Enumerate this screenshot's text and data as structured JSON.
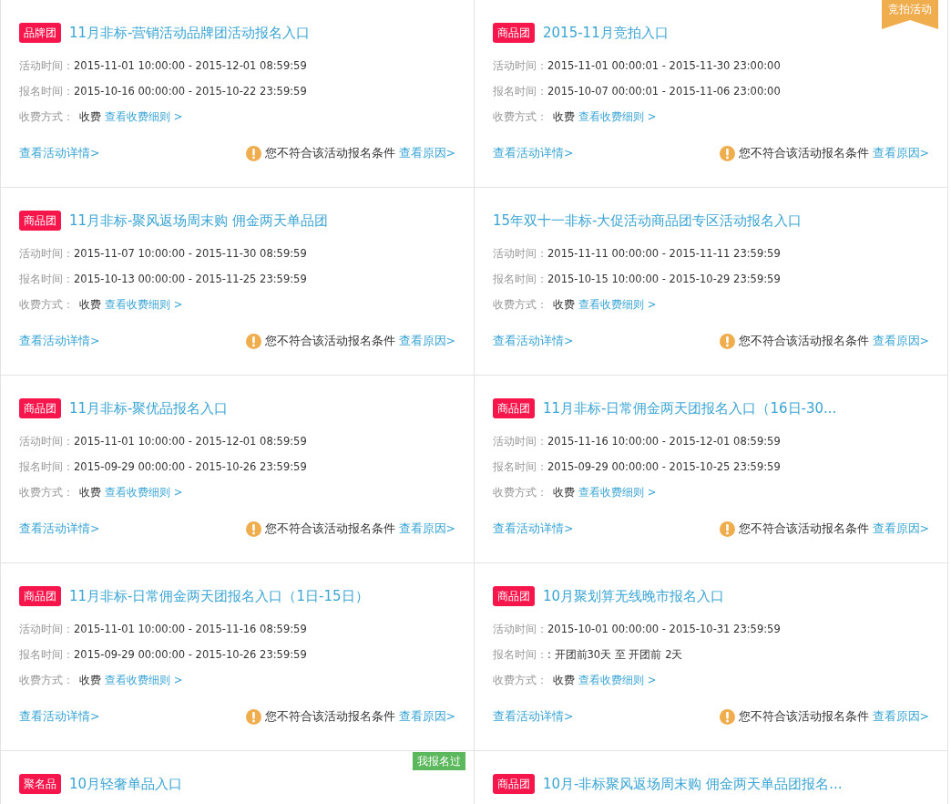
{
  "rows": [
    {
      "cards": [
        {
          "tag": "品牌团",
          "title": "11月非标-营销活动品牌团活动报名入口",
          "activity_time": {
            "label": "活动时间：",
            "value": "2015-11-01 10:00:00 - 2015-12-01 08:59:59"
          },
          "signup_time": {
            "label": "报名时间：",
            "value": "2015-10-16 00:00:00 - 2015-10-22 23:59:59"
          },
          "fee": {
            "label": "收费方式：",
            "value": "收费",
            "link": "查看收费细则 >"
          },
          "details_link": "查看活动详情>",
          "notice": {
            "text": "您不符合该活动报名条件",
            "link": "查看原因>"
          }
        },
        {
          "tag": "商品团",
          "title": "2015-11月竞拍入口",
          "corner_tag": {
            "kind": "ribbon",
            "text": "竞拍活动"
          },
          "activity_time": {
            "label": "活动时间：",
            "value": "2015-11-01 00:00:01 - 2015-11-30 23:00:00"
          },
          "signup_time": {
            "label": "报名时间：",
            "value": "2015-10-07 00:00:01 - 2015-11-06 23:00:00"
          },
          "fee": {
            "label": "收费方式：",
            "value": "收费",
            "link": "查看收费细则 >"
          },
          "details_link": "查看活动详情>",
          "notice": {
            "text": "您不符合该活动报名条件",
            "link": "查看原因>"
          }
        }
      ]
    },
    {
      "cards": [
        {
          "tag": "商品团",
          "title": "11月非标-聚风返场周末购 佣金两天单品团",
          "activity_time": {
            "label": "活动时间：",
            "value": "2015-11-07 10:00:00 - 2015-11-30 08:59:59"
          },
          "signup_time": {
            "label": "报名时间：",
            "value": "2015-10-13 00:00:00 - 2015-11-25 23:59:59"
          },
          "fee": {
            "label": "收费方式：",
            "value": "收费",
            "link": "查看收费细则 >"
          },
          "details_link": "查看活动详情>",
          "notice": {
            "text": "您不符合该活动报名条件",
            "link": "查看原因>"
          }
        },
        {
          "title": "15年双十一非标-大促活动商品团专区活动报名入口",
          "activity_time": {
            "label": "活动时间：",
            "value": "2015-11-11 00:00:00 - 2015-11-11 23:59:59"
          },
          "signup_time": {
            "label": "报名时间：",
            "value": "2015-10-15 10:00:00 - 2015-10-29 23:59:59"
          },
          "fee": {
            "label": "收费方式：",
            "value": "收费",
            "link": "查看收费细则 >"
          },
          "details_link": "查看活动详情>",
          "notice": {
            "text": "您不符合该活动报名条件",
            "link": "查看原因>"
          }
        }
      ]
    },
    {
      "cards": [
        {
          "tag": "商品团",
          "title": "11月非标-聚优品报名入口",
          "activity_time": {
            "label": "活动时间：",
            "value": "2015-11-01 10:00:00 - 2015-12-01 08:59:59"
          },
          "signup_time": {
            "label": "报名时间：",
            "value": "2015-09-29 00:00:00 - 2015-10-26 23:59:59"
          },
          "fee": {
            "label": "收费方式：",
            "value": "收费",
            "link": "查看收费细则 >"
          },
          "details_link": "查看活动详情>",
          "notice": {
            "text": "您不符合该活动报名条件",
            "link": "查看原因>"
          }
        },
        {
          "tag": "商品团",
          "title": "11月非标-日常佣金两天团报名入口（16日-30...",
          "activity_time": {
            "label": "活动时间：",
            "value": "2015-11-16 10:00:00 - 2015-12-01 08:59:59"
          },
          "signup_time": {
            "label": "报名时间：",
            "value": "2015-09-29 00:00:00 - 2015-10-25 23:59:59"
          },
          "fee": {
            "label": "收费方式：",
            "value": "收费",
            "link": "查看收费细则 >"
          },
          "details_link": "查看活动详情>",
          "notice": {
            "text": "您不符合该活动报名条件",
            "link": "查看原因>"
          }
        }
      ]
    },
    {
      "cards": [
        {
          "tag": "商品团",
          "title": "11月非标-日常佣金两天团报名入口（1日-15日）",
          "activity_time": {
            "label": "活动时间：",
            "value": "2015-11-01 10:00:00 - 2015-11-16 08:59:59"
          },
          "signup_time": {
            "label": "报名时间：",
            "value": "2015-09-29 00:00:00 - 2015-10-26 23:59:59"
          },
          "fee": {
            "label": "收费方式：",
            "value": "收费",
            "link": "查看收费细则 >"
          },
          "details_link": "查看活动详情>",
          "notice": {
            "text": "您不符合该活动报名条件",
            "link": "查看原因>"
          }
        },
        {
          "tag": "商品团",
          "title": "10月聚划算无线晚市报名入口",
          "activity_time": {
            "label": "活动时间：",
            "value": "2015-10-01 00:00:00 - 2015-10-31 23:59:59"
          },
          "signup_time": {
            "label": "报名时间：",
            "value": ": 开团前30天 至 开团前 2天"
          },
          "fee": {
            "label": "收费方式：",
            "value": "收费",
            "link": "查看收费细则 >"
          },
          "details_link": "查看活动详情>",
          "notice": {
            "text": "您不符合该活动报名条件",
            "link": "查看原因>"
          }
        }
      ]
    },
    {
      "cards": [
        {
          "tag": "聚名品",
          "title": "10月轻奢单品入口",
          "corner_tag": {
            "kind": "stamp",
            "text": "我报名过"
          }
        },
        {
          "tag": "商品团",
          "title": "10月-非标聚风返场周末购 佣金两天单品团报名..."
        }
      ]
    }
  ]
}
